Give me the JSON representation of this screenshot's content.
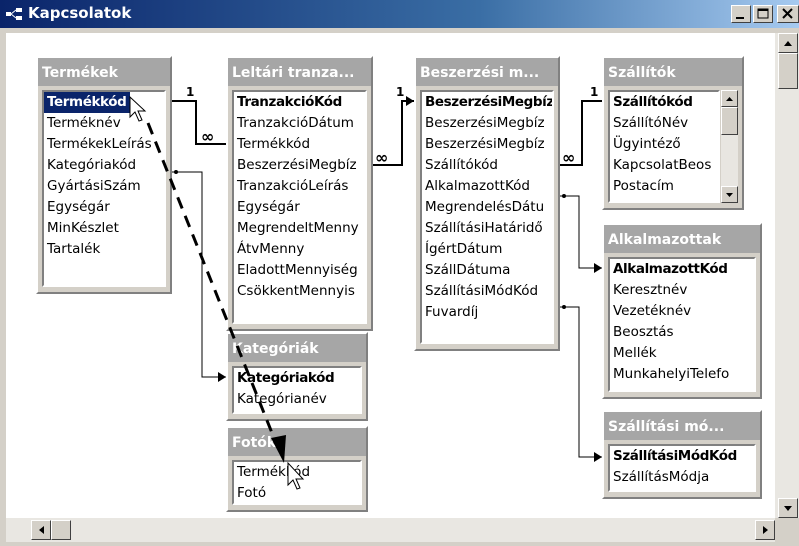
{
  "window": {
    "title": "Kapcsolatok"
  },
  "tables": [
    {
      "title": "Termékek",
      "fields": [
        {
          "name": "Termékkód",
          "key": true,
          "selected": true
        },
        {
          "name": "Terméknév"
        },
        {
          "name": "TermékekLeírás"
        },
        {
          "name": "Kategóriakód"
        },
        {
          "name": "GyártásiSzám"
        },
        {
          "name": "Egységár"
        },
        {
          "name": "MinKészlet"
        },
        {
          "name": "Tartalék"
        }
      ]
    },
    {
      "title": "Leltári tranza...",
      "fields": [
        {
          "name": "TranzakcióKód",
          "key": true
        },
        {
          "name": "TranzakcióDátum"
        },
        {
          "name": "Termékkód"
        },
        {
          "name": "BeszerzésiMegbíz"
        },
        {
          "name": "TranzakcióLeírás"
        },
        {
          "name": "Egységár"
        },
        {
          "name": "MegrendeltMenny"
        },
        {
          "name": "ÁtvMenny"
        },
        {
          "name": "EladottMennyiség"
        },
        {
          "name": "CsökkentMennyis"
        }
      ]
    },
    {
      "title": "Beszerzési m...",
      "fields": [
        {
          "name": "BeszerzésiMegbíz",
          "key": true
        },
        {
          "name": "BeszerzésiMegbíz"
        },
        {
          "name": "BeszerzésiMegbíz"
        },
        {
          "name": "Szállítókód"
        },
        {
          "name": "AlkalmazottKód"
        },
        {
          "name": "MegrendelésDátu"
        },
        {
          "name": "SzállításiHatáridő"
        },
        {
          "name": "ÍgértDátum"
        },
        {
          "name": "SzállDátuma"
        },
        {
          "name": "SzállításiMódKód"
        },
        {
          "name": "Fuvardíj"
        }
      ]
    },
    {
      "title": "Szállítók",
      "fields": [
        {
          "name": "Szállítókód",
          "key": true
        },
        {
          "name": "SzállítóNév"
        },
        {
          "name": "Ügyintéző"
        },
        {
          "name": "KapcsolatBeos"
        },
        {
          "name": "Postacím"
        }
      ]
    },
    {
      "title": "Alkalmazottak",
      "fields": [
        {
          "name": "AlkalmazottKód",
          "key": true
        },
        {
          "name": "Keresztnév"
        },
        {
          "name": "Vezetéknév"
        },
        {
          "name": "Beosztás"
        },
        {
          "name": "Mellék"
        },
        {
          "name": "MunkahelyiTelefo"
        }
      ]
    },
    {
      "title": "Kategóriák",
      "fields": [
        {
          "name": "Kategóriakód",
          "key": true
        },
        {
          "name": "Kategórianév"
        }
      ]
    },
    {
      "title": "Fotók",
      "fields": [
        {
          "name": "Termékkód"
        },
        {
          "name": "Fotó"
        }
      ]
    },
    {
      "title": "Szállítási mó...",
      "fields": [
        {
          "name": "SzállításiMódKód",
          "key": true
        },
        {
          "name": "SzállításMódja"
        }
      ]
    }
  ],
  "relationships": [
    {
      "one": "1",
      "many": "∞"
    },
    {
      "one": "1",
      "many": "∞"
    },
    {
      "one": "1",
      "many": "∞"
    }
  ]
}
